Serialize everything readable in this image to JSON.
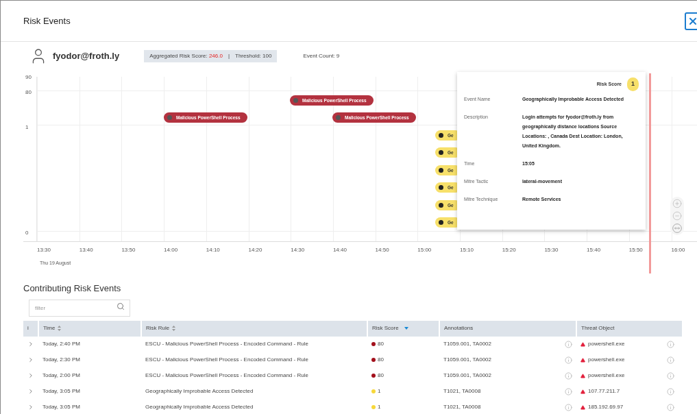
{
  "window": {
    "title": "Risk Events"
  },
  "user": {
    "name": "fyodor@froth.ly"
  },
  "summary": {
    "score_label": "Aggregated Risk Score:",
    "score": "246.0",
    "separator": "|",
    "threshold": "Threshold: 100"
  },
  "event_count": "Event Count: 9",
  "timeline": {
    "y_labels": [
      "90",
      "80",
      "1",
      "0"
    ],
    "x_labels": [
      "13:30",
      "13:40",
      "13:50",
      "14:00",
      "14:10",
      "14:20",
      "14:30",
      "14:40",
      "14:50",
      "15:00",
      "15:10",
      "15:20",
      "15:30",
      "15:40",
      "15:50",
      "16:00"
    ],
    "date": "Thu 19 August",
    "events": [
      {
        "label": "Malicious PowerShell Process",
        "kind": "high",
        "color": "#b3323f"
      },
      {
        "label": "Malicious PowerShell Process",
        "kind": "high",
        "color": "#b3323f"
      },
      {
        "label": "Malicious PowerShell Process",
        "kind": "high",
        "color": "#b3323f"
      },
      {
        "label": "Ge",
        "kind": "low",
        "color": "#f7e06a"
      },
      {
        "label": "Ge",
        "kind": "low",
        "color": "#f7e06a"
      },
      {
        "label": "Ge",
        "kind": "low",
        "color": "#f7e06a"
      },
      {
        "label": "Ge",
        "kind": "low",
        "color": "#f7e06a"
      },
      {
        "label": "Ge",
        "kind": "low",
        "color": "#f7e06a"
      },
      {
        "label": "Ge",
        "kind": "low",
        "color": "#f7e06a"
      }
    ],
    "tooltip": {
      "title": "Risk Score",
      "score": "1",
      "fields": [
        {
          "label": "Event Name",
          "value": "Geographically Improbable Access Detected"
        },
        {
          "label": "Description",
          "value": "Login attempts for fyodor@froth.ly from geographically distance locations Source Locations: , Canada Dest Location: London, United Kingdom."
        },
        {
          "label": "Time",
          "value": "15:05"
        },
        {
          "label": "Mitre Tactic",
          "value": "lateral-movement"
        },
        {
          "label": "Mitre Technique",
          "value": "Remote Services"
        }
      ]
    }
  },
  "table": {
    "title": "Contributing Risk Events",
    "filter": {
      "placeholder": "filter"
    },
    "columns": [
      {
        "label": "i",
        "sortable": false,
        "sorted": false
      },
      {
        "label": "Time",
        "sortable": true,
        "sorted": false
      },
      {
        "label": "Risk Rule",
        "sortable": true,
        "sorted": false
      },
      {
        "label": "Risk Score",
        "sortable": true,
        "sorted": true
      },
      {
        "label": "Annotations",
        "sortable": false,
        "sorted": false
      },
      {
        "label": "Threat Object",
        "sortable": false,
        "sorted": false
      }
    ],
    "rows": [
      {
        "time": "Today, 2:40 PM",
        "rule": "ESCU - Malicious PowerShell Process - Encoded Command - Rule",
        "score": "80",
        "color": "#a3101c",
        "annotations": "T1059.001, TA0002",
        "threat": "powershell.exe"
      },
      {
        "time": "Today, 2:30 PM",
        "rule": "ESCU - Malicious PowerShell Process - Encoded Command - Rule",
        "score": "80",
        "color": "#a3101c",
        "annotations": "T1059.001, TA0002",
        "threat": "powershell.exe"
      },
      {
        "time": "Today, 2:00 PM",
        "rule": "ESCU - Malicious PowerShell Process - Encoded Command - Rule",
        "score": "80",
        "color": "#a3101c",
        "annotations": "T1059.001, TA0002",
        "threat": "powershell.exe"
      },
      {
        "time": "Today, 3:05 PM",
        "rule": "Geographically Improbable Access Detected",
        "score": "1",
        "color": "#f7d83a",
        "annotations": "T1021, TA0008",
        "threat": "107.77.211.7"
      },
      {
        "time": "Today, 3:05 PM",
        "rule": "Geographically Improbable Access Detected",
        "score": "1",
        "color": "#f7d83a",
        "annotations": "T1021, TA0008",
        "threat": "185.192.69.97"
      }
    ]
  }
}
